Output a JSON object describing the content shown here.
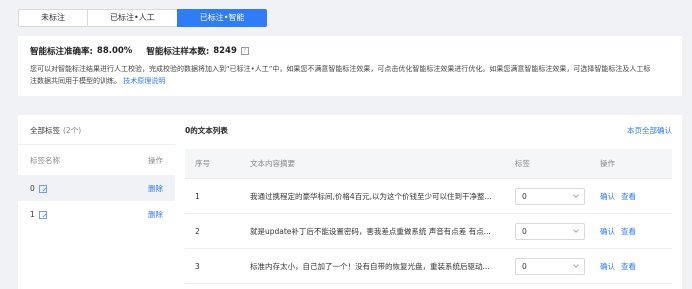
{
  "tabs": [
    "未标注",
    "已标注•人工",
    "已标注•智能"
  ],
  "info": {
    "accuracy_label": "智能标注准确率:",
    "accuracy_value": "88.00%",
    "sample_label": "智能标注样本数:",
    "sample_value": "8249",
    "help": "?",
    "desc1": "您可以对智能标注结果进行人工校验，完成校验的数据将加入到“已标注•人工”中，如果您不满意智能标注效果，可点击优化智能标注效果进行优化。如果您满意智能标注效果，可选择智能标注及人工标",
    "desc2": "注数据共同用于模型的训练。",
    "link": "技术原理说明"
  },
  "labels": {
    "title": "全部标签",
    "count": "(2个)",
    "col_name": "标签名称",
    "col_op": "操作",
    "delete": "删除",
    "items": [
      "0",
      "1"
    ]
  },
  "list": {
    "title": "0的文本列表",
    "confirm_all": "本页全部确认",
    "headers": [
      "序号",
      "文本内容摘要",
      "标签",
      "操作"
    ],
    "confirm": "确认",
    "view": "查看",
    "rows": [
      {
        "no": "1",
        "text": "我通过携程定的豪华标间,价格4百元,以为这个价钱至少可以住到干净整...",
        "tag": "0"
      },
      {
        "no": "2",
        "text": "就是update补丁后不能设置密码，害我差点重做系统 声音有点差 有点...",
        "tag": "0"
      },
      {
        "no": "3",
        "text": "标准内存太小，自己加了一个！没有自带的恢复光盘，重装系统后驱动...",
        "tag": "0"
      }
    ]
  }
}
